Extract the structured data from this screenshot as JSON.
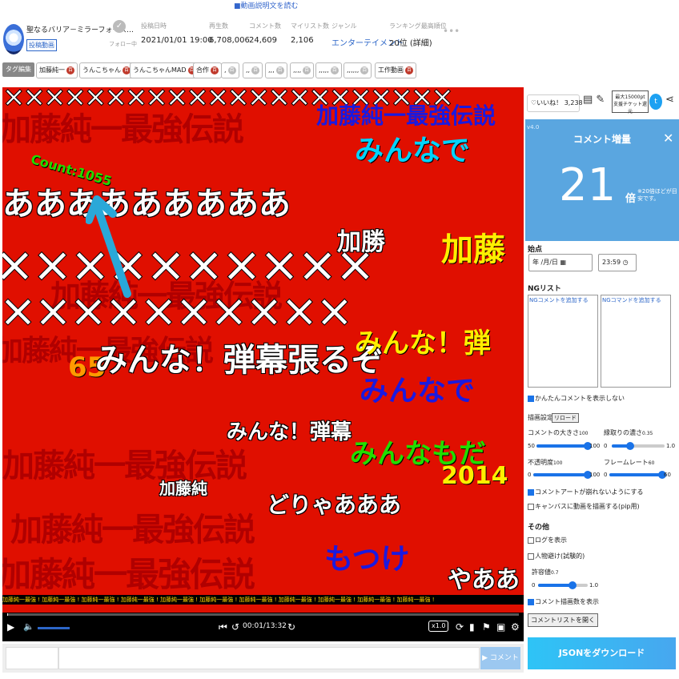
{
  "top_note": "■動画説明文を読む",
  "header": {
    "video_title": "聖なるバリア－ミラーフォース…",
    "channel_badge": "投稿動画",
    "follow_label": "フォロー中",
    "stats": [
      {
        "label": "投稿日時",
        "value": "2021/01/01 19:00"
      },
      {
        "label": "再生数",
        "value": "6,708,006"
      },
      {
        "label": "コメント数",
        "value": "24,609"
      },
      {
        "label": "マイリスト数",
        "value": "2,106"
      },
      {
        "label": "ジャンル",
        "value": "エンターテイメント"
      },
      {
        "label": "ランキング最高順位",
        "value": "20位 (詳細)"
      }
    ],
    "more": "•••"
  },
  "tags": {
    "edit_label": "タグ編集",
    "items": [
      "加藤純一",
      "うんこちゃん",
      "うんこちゃんMAD",
      "合作",
      ",",
      ",,",
      ",,,",
      ",,,,",
      ",,,,,",
      ",,,,,,",
      "工作動画"
    ],
    "dic_mark": "百"
  },
  "video": {
    "counter": "Count:1055",
    "comments": [
      "加藤純一最強伝説",
      "みんな！弾幕張るぞ",
      "あああああああああ",
      "みんな！弾幕張るぞ",
      "みんな！弾幕",
      "みんな！弾",
      "みんなもだ",
      "みんなで",
      "加勝",
      "加藤",
      "もつけ",
      "どりゃあああ",
      "65",
      "加藤純",
      "2014",
      "やああ"
    ],
    "hud_strip": "加藤純一最強 ! 加藤純一最強 ! 加藤純一最強 ! 加藤純一最強 ! 加藤純一最強 ! 加藤純一最強 ! 加藤純一最強 ! 加藤純一最強 ! 加藤純一最強 ! 加藤純一最強 ! 加藤純一最強 !",
    "time": "00:01/13:32",
    "speed": "x1.0",
    "progress": 0.0014
  },
  "comment_bar": {
    "placeholder": "",
    "send_label": "コメント"
  },
  "panel": {
    "like_label": "いいね！",
    "like_count": "3,238",
    "promo": "最大15000pt 支援チケット還元",
    "version": "v4.0",
    "increase_title": "コメント増量",
    "increase_value": "21",
    "increase_unit": "倍",
    "increase_note": "※20倍ほどが目安です。",
    "start_label": "始点",
    "date_value": "年 /月/日",
    "time_value": "23:59",
    "ng_title": "NGリスト",
    "ng_comment_placeholder": "NGコメントを追加する",
    "ng_command_placeholder": "NGコマンドを追加する",
    "hide_easy_comment": "かんたんコメントを表示しない",
    "render_settings": "描画設定",
    "reload": "リロード",
    "sliders": [
      {
        "label": "コメントの大きさ",
        "sub": "100",
        "min": "50",
        "max": "100",
        "value": 1.0
      },
      {
        "label": "縁取りの濃さ",
        "sub": "0.35",
        "min": "0",
        "max": "1.0",
        "value": 0.35
      },
      {
        "label": "不透明度",
        "sub": "100",
        "min": "0",
        "max": "100",
        "value": 1.0
      },
      {
        "label": "フレームレート",
        "sub": "60",
        "min": "0",
        "max": "60",
        "value": 1.0
      }
    ],
    "cb_art": "コメントアートが崩れないようにする",
    "cb_pip": "キャンバスに動画を描画する(pip用)",
    "other_title": "その他",
    "cb_log": "ログを表示",
    "cb_person": "人物避け(試験的)",
    "tolerance_label": "許容値",
    "tolerance_sub": "0.7",
    "tolerance_min": "0",
    "tolerance_max": "1.0",
    "tolerance_value": 0.7,
    "cb_count": "コメント描画数を表示",
    "open_list": "コメントリストを開く",
    "download_json": "JSONをダウンロード"
  },
  "colors": {
    "accent": "#1a73e8",
    "video_bg": "#e00f00",
    "panel_blue": "#5aa6e0"
  },
  "icons": [
    "check-icon",
    "play-icon",
    "volume-icon",
    "skip-back-icon",
    "replay-icon",
    "forward-icon",
    "loop-icon",
    "comment-icon",
    "pip-icon",
    "fullscreen-icon",
    "settings-icon",
    "heart-icon",
    "twitter-icon",
    "share-icon"
  ]
}
